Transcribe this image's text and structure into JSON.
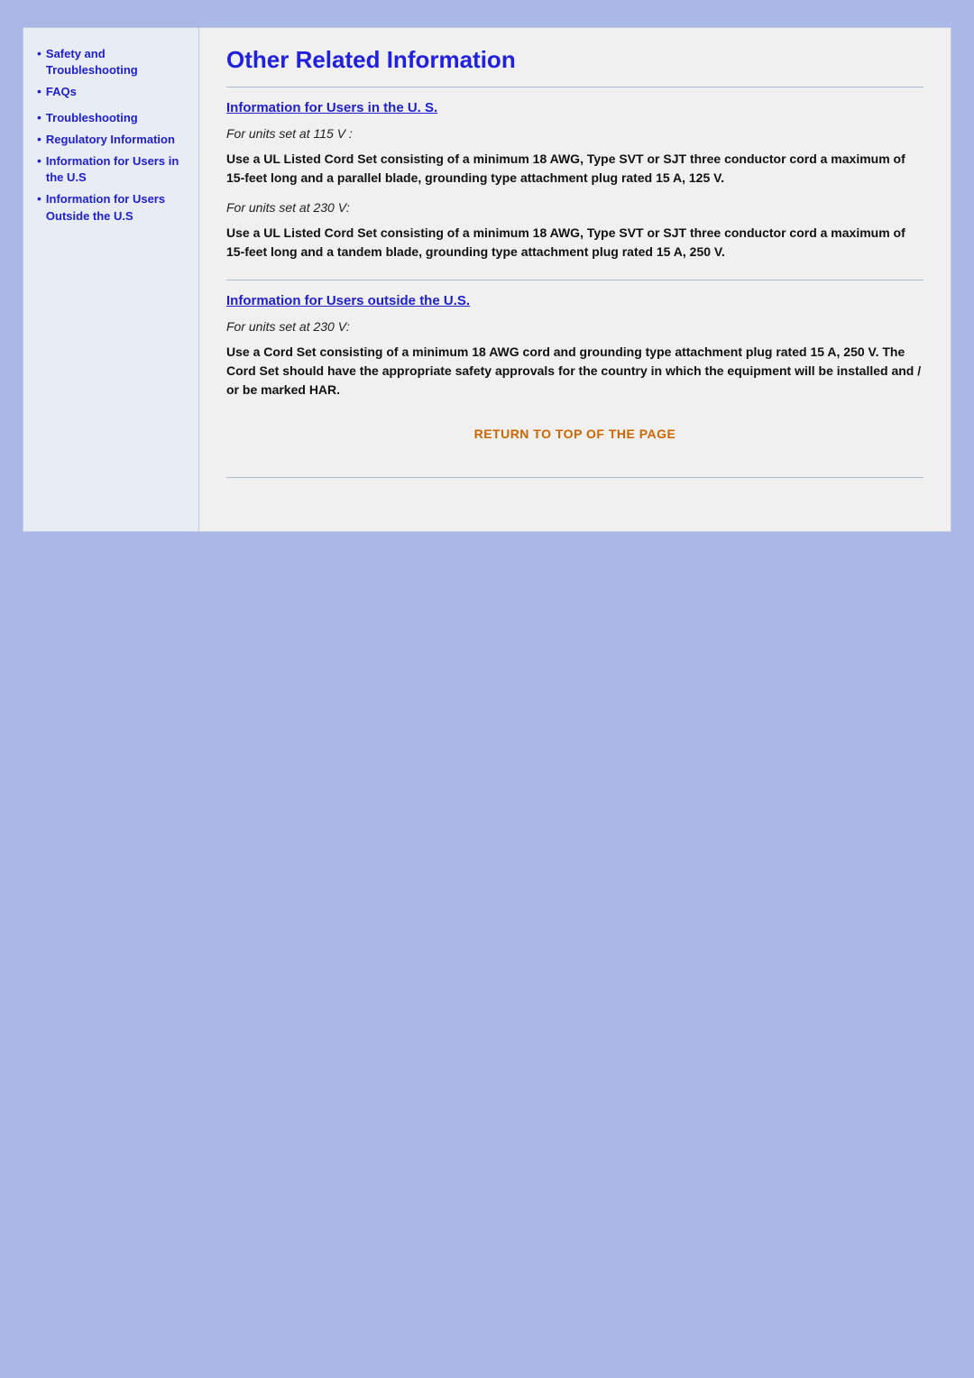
{
  "page": {
    "background_color": "#aab8e8"
  },
  "sidebar": {
    "groups": [
      {
        "items": [
          {
            "label": "Safety and Troubleshooting",
            "indent": false
          },
          {
            "label": "FAQs",
            "indent": false
          }
        ]
      },
      {
        "items": [
          {
            "label": "Troubleshooting",
            "indent": false
          },
          {
            "label": "Regulatory Information",
            "indent": false
          },
          {
            "label": "Information for Users in the U.S",
            "indent": false
          },
          {
            "label": "Information for Users Outside the U.S",
            "indent": false
          }
        ]
      }
    ]
  },
  "main": {
    "title": "Other Related Information",
    "sections": [
      {
        "id": "us-section",
        "heading": "Information for Users in the U. S.",
        "blocks": [
          {
            "type": "italic",
            "text": "For units set at 115 V :"
          },
          {
            "type": "bold",
            "text": "Use a UL Listed Cord Set consisting of a minimum 18 AWG, Type SVT or SJT three conductor cord a maximum of 15-feet long and a parallel blade, grounding type attachment plug rated 15 A, 125 V."
          },
          {
            "type": "italic",
            "text": "For units set at 230 V:"
          },
          {
            "type": "bold",
            "text": "Use a UL Listed Cord Set consisting of a minimum 18 AWG, Type SVT or SJT three conductor cord a maximum of 15-feet long and a tandem blade, grounding type attachment plug rated 15 A, 250 V."
          }
        ]
      },
      {
        "id": "outside-us-section",
        "heading": "Information for Users outside the U.S.",
        "blocks": [
          {
            "type": "italic",
            "text": "For units set at 230 V:"
          },
          {
            "type": "bold",
            "text": "Use a Cord Set consisting of a minimum 18 AWG cord and grounding type attachment plug rated 15 A, 250 V. The Cord Set should have the appropriate safety approvals for the country in which the equipment will be installed and / or be marked HAR."
          }
        ]
      }
    ],
    "return_link": "RETURN TO TOP OF THE PAGE"
  }
}
